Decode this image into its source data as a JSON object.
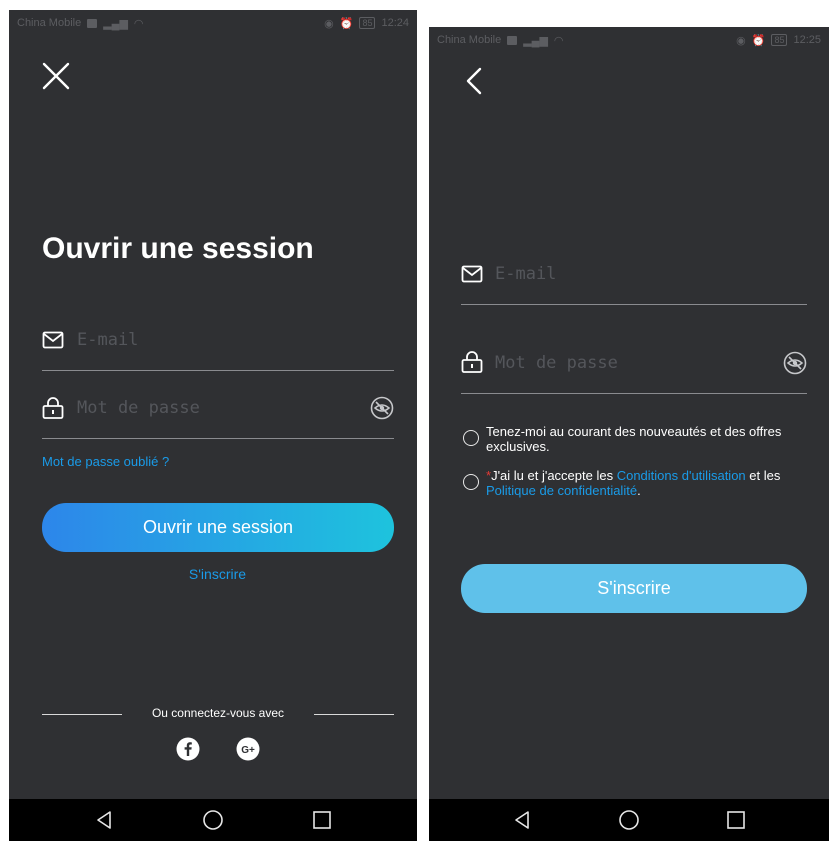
{
  "login": {
    "status": {
      "carrier": "China Mobile",
      "time": "12:24",
      "battery": "85"
    },
    "title": "Ouvrir une session",
    "email_placeholder": "E-mail",
    "password_placeholder": "Mot de passe",
    "forgot_password": "Mot de passe oublié ?",
    "login_button": "Ouvrir une session",
    "register_link": "S'inscrire",
    "social_divider": "Ou connectez-vous avec",
    "social": [
      "facebook",
      "google-plus"
    ]
  },
  "register": {
    "status": {
      "carrier": "China Mobile",
      "time": "12:25",
      "battery": "85"
    },
    "email_placeholder": "E-mail",
    "password_placeholder": "Mot de passe",
    "newsletter_text": "Tenez-moi au courant des nouveautés et des offres exclusives.",
    "terms": {
      "required_mark": "*",
      "prefix": "J'ai lu et j'accepte les ",
      "conditions_link": "Conditions d'utilisation",
      "middle": " et les ",
      "privacy_link": "Politique de confidentialité",
      "suffix": "."
    },
    "register_button": "S'inscrire"
  },
  "colors": {
    "background": "#2f3033",
    "accent_link": "#1a9be8",
    "login_gradient": [
      "#2d86ea",
      "#1ec3dd"
    ],
    "register_button": "#5fc1ea",
    "required": "#e53935"
  },
  "icons": [
    "close-icon",
    "back-icon",
    "mail-icon",
    "lock-icon",
    "eye-hidden-icon",
    "facebook-icon",
    "google-plus-icon",
    "nav-back-icon",
    "nav-home-icon",
    "nav-recent-icon"
  ]
}
